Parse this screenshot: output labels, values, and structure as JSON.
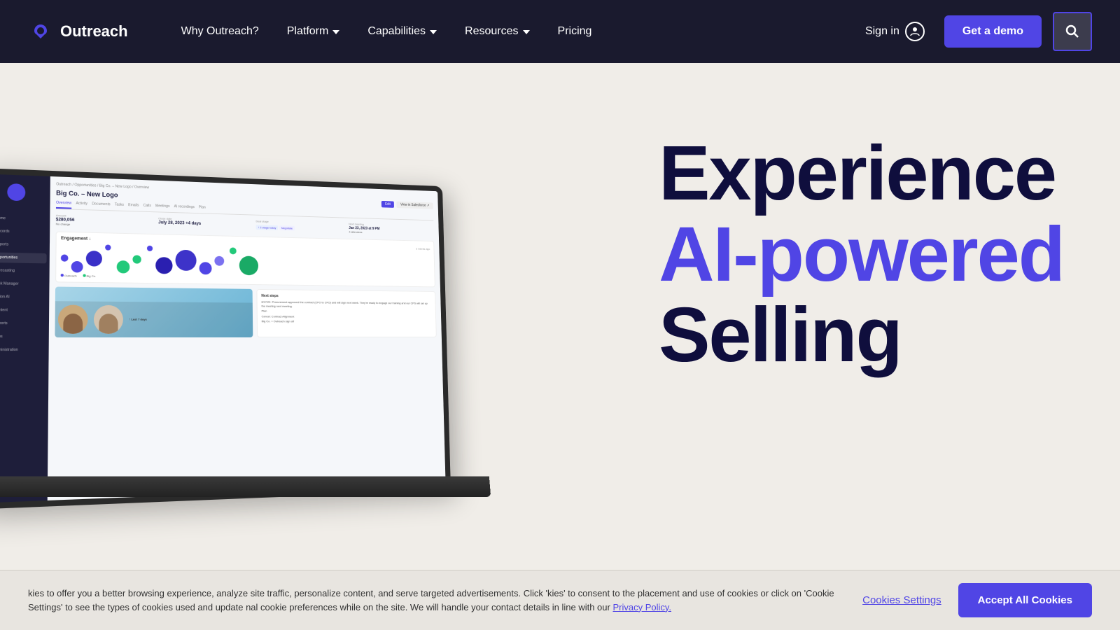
{
  "nav": {
    "logo_text": "Outreach",
    "links": [
      {
        "label": "Why Outreach?",
        "has_dropdown": false
      },
      {
        "label": "Platform",
        "has_dropdown": true
      },
      {
        "label": "Capabilities",
        "has_dropdown": true
      },
      {
        "label": "Resources",
        "has_dropdown": true
      },
      {
        "label": "Pricing",
        "has_dropdown": false
      }
    ],
    "sign_in": "Sign in",
    "get_demo": "Get a demo"
  },
  "hero": {
    "headline_line1": "Experience",
    "headline_line2": "AI-powered",
    "headline_line3": "Selling"
  },
  "app_screen": {
    "breadcrumb": "Outreach  /  Opportunities  /  Big Co. – New Logo  /  Overview",
    "title": "Big Co. – New Logo",
    "tabs": [
      "Overview",
      "Activity",
      "Documents",
      "Tasks",
      "Emails",
      "Calls",
      "Meetings",
      "AI recordings",
      "Plan"
    ],
    "details": [
      {
        "label": "Amount",
        "value": "$280,056",
        "sub": "No change"
      },
      {
        "label": "Close date",
        "value": "July 28, 2023",
        "sub": "+4 days"
      },
      {
        "label": "Deal stage",
        "value": "Negotiate"
      },
      {
        "label": "Next meeting",
        "value": "Jan 23, 2023 at 9 PM",
        "sub": "4 attendees"
      }
    ],
    "engagement_title": "Engagement",
    "legend": [
      "Outreach",
      "Big Co."
    ],
    "next_steps_title": "Next steps",
    "next_steps": [
      "8/17/22: Procurement approved the contract (CFO to CFO) and will sign next week. They're ready to engage our training and our CPS will set up the meeting next meeting.",
      "Plan",
      "Cancel: Contract Alignment",
      "Big Co. + Outreach sign off"
    ]
  },
  "cookie_banner": {
    "text": "kies to offer you a better browsing experience, analyze site traffic, personalize content, and serve targeted advertisements. Click 'kies' to consent to the placement and use of cookies or click on 'Cookie Settings' to see the types of cookies used and update nal cookie preferences while on the site. We will handle your contact details in line with our",
    "link_text": "Privacy Policy.",
    "settings_label": "Cookies Settings",
    "accept_label": "Accept All Cookies"
  }
}
